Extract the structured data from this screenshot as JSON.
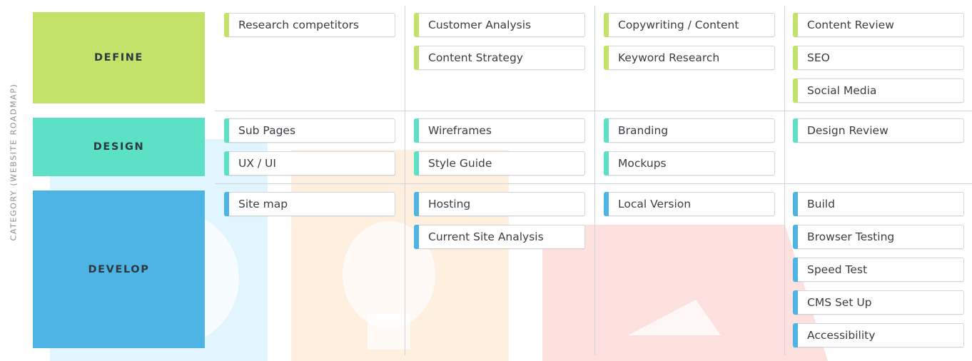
{
  "axis_label": "CATEGORY (WEBSITE ROADMAP)",
  "colors": {
    "define": "#c2e26a",
    "design": "#5ce1c6",
    "develop": "#4eb4e6"
  },
  "categories": [
    {
      "label": "DEFINE",
      "color": "#c2e26a"
    },
    {
      "label": "DESIGN",
      "color": "#5ce1c6"
    },
    {
      "label": "DEVELOP",
      "color": "#4eb4e6"
    }
  ],
  "tasks": {
    "define": [
      [
        "Research competitors"
      ],
      [
        "Customer Analysis",
        "Content Strategy"
      ],
      [
        "Copywriting / Content",
        "Keyword Research"
      ],
      [
        "Content Review",
        "SEO",
        "Social Media"
      ]
    ],
    "design": [
      [
        "Sub Pages",
        "UX / UI"
      ],
      [
        "Wireframes",
        "Style Guide"
      ],
      [
        "Branding",
        "Mockups"
      ],
      [
        "Design Review"
      ]
    ],
    "develop": [
      [
        "Site map"
      ],
      [
        "Hosting",
        "Current Site Analysis"
      ],
      [
        "Local Version"
      ],
      [
        "Build",
        "Browser Testing",
        "Speed Test",
        "CMS Set Up",
        "Accessibility"
      ]
    ]
  }
}
